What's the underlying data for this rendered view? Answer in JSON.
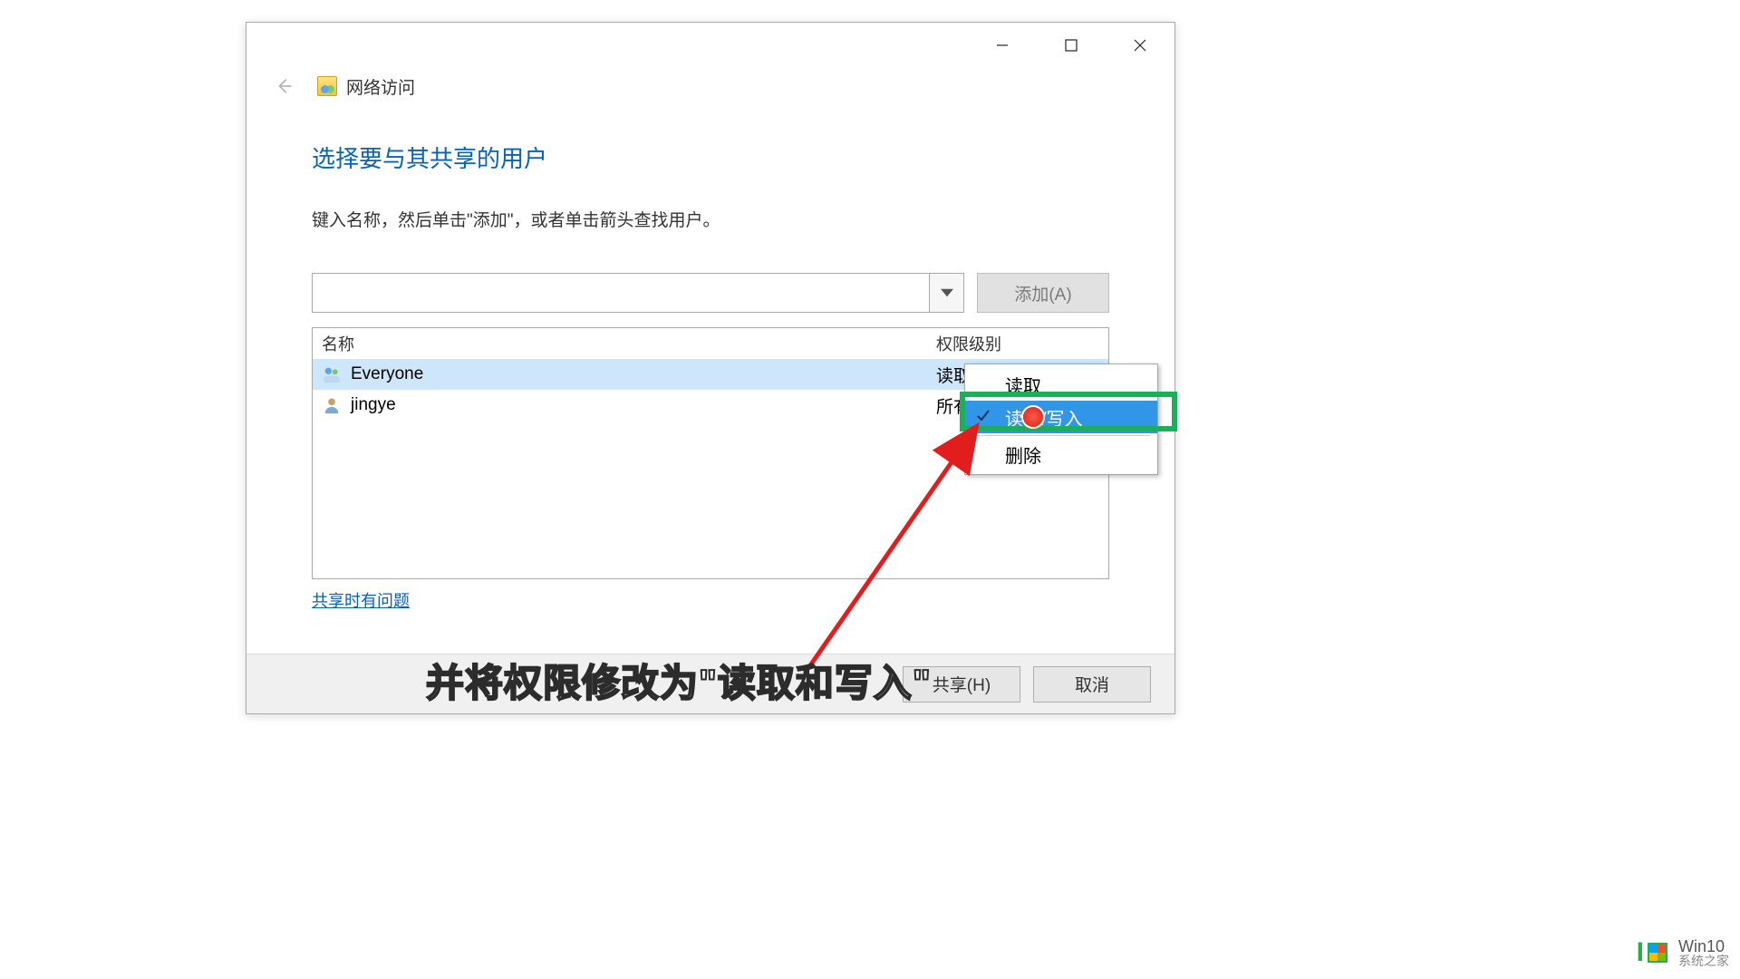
{
  "window": {
    "title": "网络访问",
    "heading": "选择要与其共享的用户",
    "instruction": "键入名称，然后单击\"添加\"，或者单击箭头查找用户。",
    "add_button": "添加(A)",
    "help_link": "共享时有问题",
    "share_button": "共享(H)",
    "cancel_button": "取消"
  },
  "list": {
    "col_name": "名称",
    "col_perm": "权限级别",
    "rows": [
      {
        "name": "Everyone",
        "perm": "读取/写入",
        "selected": true,
        "icon": "group"
      },
      {
        "name": "jingye",
        "perm": "所有者",
        "selected": false,
        "icon": "user"
      }
    ]
  },
  "menu": {
    "read": "读取",
    "readwrite": "读取/写入",
    "remove": "删除"
  },
  "caption": "并将权限修改为\"读取和写入\"",
  "watermark": {
    "brand": "Win10",
    "sub": "系统之家"
  }
}
